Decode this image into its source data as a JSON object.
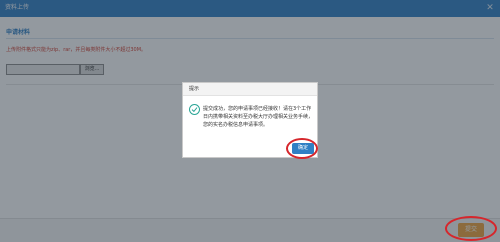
{
  "window": {
    "title": "资料上传"
  },
  "section": {
    "title": "申请材料",
    "warning": "上传附件格式只能为zip、rar，并且每类附件大小不超过30M。"
  },
  "upload": {
    "browse_label": "浏览..."
  },
  "footer": {
    "submit_label": "提交"
  },
  "dialog": {
    "title": "提示",
    "message": "提交成功，您的申请事项已经接收！请在3个工作日内携带相关资料至办税大厅办理相关业务手续，您的实名办税信息申请事项。",
    "ok_label": "确定"
  },
  "colors": {
    "titlebar": "#2f7fc4",
    "warning_text": "#d0392b",
    "submit_button": "#f0a33a",
    "annotation_ring": "#d6262c",
    "check": "#2aa596"
  }
}
